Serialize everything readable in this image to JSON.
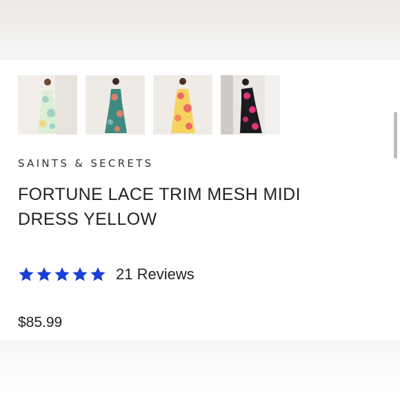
{
  "product": {
    "brand": "SAINTS & SECRETS",
    "title": "FORTUNE LACE TRIM MESH MIDI DRESS YELLOW",
    "rating": 5,
    "reviews_label": "21 Reviews",
    "price": "$85.99",
    "star_color": "#1a3ed8"
  },
  "gallery": {
    "thumbnails": [
      {
        "label": "mint floral dress",
        "dress_color": "#dbeed3",
        "accent": "#9fd1c6"
      },
      {
        "label": "teal floral dress",
        "dress_color": "#3f8a80",
        "accent": "#d9826b"
      },
      {
        "label": "yellow floral dress",
        "dress_color": "#f5d35e",
        "accent": "#ef6a6a"
      },
      {
        "label": "black pink floral dress",
        "dress_color": "#1b1b1f",
        "accent": "#e0357a"
      }
    ]
  }
}
